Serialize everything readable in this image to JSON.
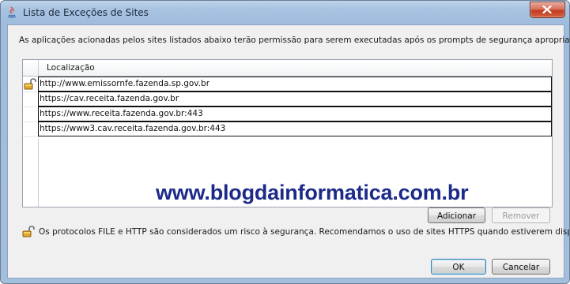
{
  "window": {
    "title": "Lista de Exceções de Sites"
  },
  "description": "As aplicações acionadas pelos sites listados abaixo terão permissão para serem executadas após os prompts de segurança apropriados.",
  "table": {
    "column_header": "Localização",
    "rows": [
      {
        "url": "http://www.emissornfe.fazenda.sp.gov.br",
        "insecure_lock": true
      },
      {
        "url": "https://cav.receita.fazenda.gov.br",
        "insecure_lock": false
      },
      {
        "url": "https://www.receita.fazenda.gov.br:443",
        "insecure_lock": false
      },
      {
        "url": "https://www3.cav.receita.fazenda.gov.br:443",
        "insecure_lock": false
      }
    ]
  },
  "watermark": "www.blogdainformatica.com.br",
  "buttons": {
    "add": "Adicionar",
    "remove": "Remover",
    "ok": "OK",
    "cancel": "Cancelar"
  },
  "security_note": "Os protocolos FILE e HTTP são considerados um risco à segurança. Recomendamos o uso de sites HTTPS quando estiverem disponíveis.",
  "colors": {
    "title_bar": "#a9c4e2",
    "close_button": "#c23a22",
    "watermark": "#1c2a8a"
  },
  "icons": {
    "title": "java-icon",
    "close": "close-icon",
    "lock": "open-padlock-icon"
  }
}
